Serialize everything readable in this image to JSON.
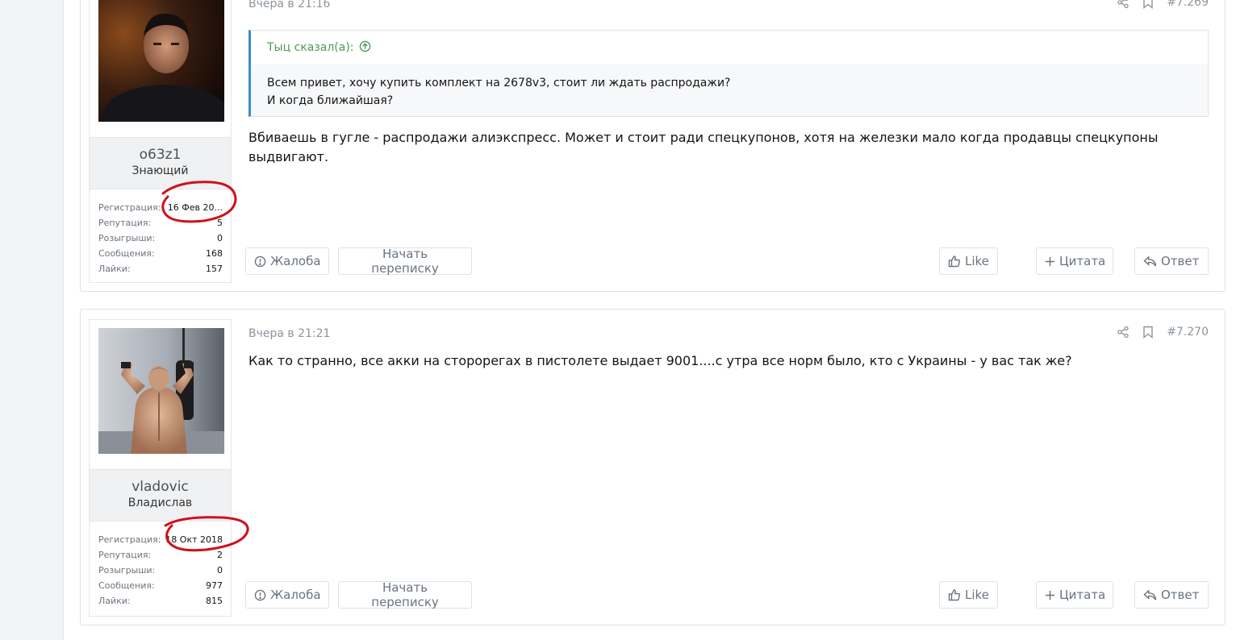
{
  "posts": [
    {
      "username": "o63z1",
      "usertitle": "Знающий",
      "stats": [
        {
          "label": "Регистрация:",
          "value": "16 Фев 20..."
        },
        {
          "label": "Репутация:",
          "value": "5"
        },
        {
          "label": "Розыгрыши:",
          "value": "0"
        },
        {
          "label": "Сообщения:",
          "value": "168"
        },
        {
          "label": "Лайки:",
          "value": "157"
        }
      ],
      "date": "Вчера в 21:16",
      "number": "#7.269",
      "quote": {
        "author": "Тыц сказал(а):",
        "line1": "Всем привет, хочу купить комплект на 2678v3, стоит ли ждать распродажи?",
        "line2": "И когда ближайшая?"
      },
      "text": "Вбиваешь в гугле - распродажи алиэкспресс. Может и стоит ради спецкупонов, хотя на железки мало когда продавцы спецкупоны выдвигают."
    },
    {
      "username": "vladovic",
      "usertitle": "Владислав",
      "stats": [
        {
          "label": "Регистрация:",
          "value": "18 Окт 2018"
        },
        {
          "label": "Репутация:",
          "value": "2"
        },
        {
          "label": "Розыгрыши:",
          "value": "0"
        },
        {
          "label": "Сообщения:",
          "value": "977"
        },
        {
          "label": "Лайки:",
          "value": "815"
        }
      ],
      "date": "Вчера в 21:21",
      "number": "#7.270",
      "text": "Как то странно, все акки на сторорегах в пистолете выдает 9001....с утра все норм было, кто с Украины - у вас так же?"
    }
  ],
  "actions": {
    "report": "Жалоба",
    "conversation": "Начать переписку",
    "like": "Like",
    "quote": "Цитата",
    "reply": "Ответ"
  },
  "colors": {
    "accent": "#3a8fc7",
    "quote_author": "#4b9a55",
    "annotation": "#d0101a"
  },
  "icons": [
    "share-icon",
    "bookmark-icon",
    "arrow-up-circle-icon",
    "exclamation-circle-icon",
    "thumbs-up-icon",
    "plus-icon",
    "reply-arrow-icon"
  ]
}
